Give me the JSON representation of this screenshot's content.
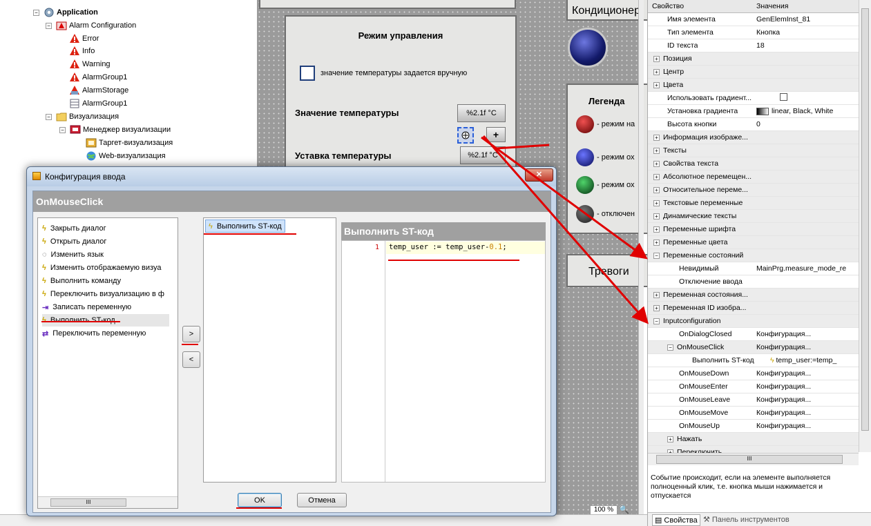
{
  "tree": {
    "items": [
      {
        "label": "Application",
        "icon": "gear-icon",
        "level": 0
      },
      {
        "label": "Alarm Configuration",
        "icon": "alarm-config-icon",
        "level": 1
      },
      {
        "label": "Error",
        "icon": "warning-icon",
        "level": 2
      },
      {
        "label": "Info",
        "icon": "warning-icon",
        "level": 2
      },
      {
        "label": "Warning",
        "icon": "warning-icon",
        "level": 2
      },
      {
        "label": "AlarmGroup1",
        "icon": "warning-icon",
        "level": 2
      },
      {
        "label": "AlarmStorage",
        "icon": "alarm-storage-icon",
        "level": 2
      },
      {
        "label": "AlarmGroup1",
        "icon": "table-icon",
        "level": 2
      },
      {
        "label": "Визуализация",
        "icon": "folder-icon",
        "level": 1
      },
      {
        "label": "Менеджер визуализации",
        "icon": "visu-manager-icon",
        "level": 2
      },
      {
        "label": "Таргет-визуализация",
        "icon": "target-visu-icon",
        "level": 3
      },
      {
        "label": "Web-визуализация",
        "icon": "web-visu-icon",
        "level": 3
      }
    ]
  },
  "canvas": {
    "mode_title": "Режим управления",
    "manual_checkbox_label": "значение температуры задается вручную",
    "temp_value_label": "Значение температуры",
    "temp_value_format": "%2.1f °C",
    "setpoint_label": "Уставка температуры",
    "setpoint_format": "%2.1f °C",
    "plus_label": "+",
    "cond_title": "Кондиционер",
    "legend_title": "Легенда",
    "legend_items": [
      "- режим на",
      "- режим ох",
      "- режим ох",
      "- отключен"
    ],
    "alarm_title": "Тревоги",
    "zoom": "100 %"
  },
  "props": {
    "header": {
      "name": "Свойство",
      "value": "Значения"
    },
    "rows": [
      {
        "k": "Имя элемента",
        "v": "GenElemInst_81",
        "lvl": 1,
        "cat": false
      },
      {
        "k": "Тип элемента",
        "v": "Кнопка",
        "lvl": 1,
        "cat": false
      },
      {
        "k": "ID текста",
        "v": "18",
        "lvl": 1,
        "cat": false
      },
      {
        "k": "Позиция",
        "v": "",
        "lvl": 0,
        "cat": true,
        "pm": "+"
      },
      {
        "k": "Центр",
        "v": "",
        "lvl": 0,
        "cat": true,
        "pm": "+"
      },
      {
        "k": "Цвета",
        "v": "",
        "lvl": 0,
        "cat": true,
        "pm": "+"
      },
      {
        "k": "Использовать градиент...",
        "v": "",
        "lvl": 1,
        "cat": false,
        "check": true
      },
      {
        "k": "Установка градиента",
        "v": "linear, Black, White",
        "lvl": 1,
        "cat": false,
        "grad": true
      },
      {
        "k": "Высота кнопки",
        "v": "0",
        "lvl": 1,
        "cat": false
      },
      {
        "k": "Информация изображе...",
        "v": "",
        "lvl": 0,
        "cat": true,
        "pm": "+"
      },
      {
        "k": "Тексты",
        "v": "",
        "lvl": 0,
        "cat": true,
        "pm": "+"
      },
      {
        "k": "Свойства текста",
        "v": "",
        "lvl": 0,
        "cat": true,
        "pm": "+"
      },
      {
        "k": "Абсолютное перемещен...",
        "v": "",
        "lvl": 0,
        "cat": true,
        "pm": "+"
      },
      {
        "k": "Относительное переме...",
        "v": "",
        "lvl": 0,
        "cat": true,
        "pm": "+"
      },
      {
        "k": "Текстовые переменные",
        "v": "",
        "lvl": 0,
        "cat": true,
        "pm": "+"
      },
      {
        "k": "Динамические тексты",
        "v": "",
        "lvl": 0,
        "cat": true,
        "pm": "+"
      },
      {
        "k": "Переменные шрифта",
        "v": "",
        "lvl": 0,
        "cat": true,
        "pm": "+"
      },
      {
        "k": "Переменные цвета",
        "v": "",
        "lvl": 0,
        "cat": true,
        "pm": "+"
      },
      {
        "k": "Переменные состояний",
        "v": "",
        "lvl": 0,
        "cat": true,
        "pm": "−"
      },
      {
        "k": "Невидимый",
        "v": "MainPrg.measure_mode_re",
        "lvl": 2,
        "cat": false
      },
      {
        "k": "Отключение ввода",
        "v": "",
        "lvl": 2,
        "cat": false
      },
      {
        "k": "Переменная состояния...",
        "v": "",
        "lvl": 0,
        "cat": true,
        "pm": "+"
      },
      {
        "k": "Переменная ID изобра...",
        "v": "",
        "lvl": 0,
        "cat": true,
        "pm": "+"
      },
      {
        "k": "Inputconfiguration",
        "v": "",
        "lvl": 0,
        "cat": true,
        "pm": "−"
      },
      {
        "k": "OnDialogClosed",
        "v": "Конфигурация...",
        "lvl": 2,
        "cat": false
      },
      {
        "k": "OnMouseClick",
        "v": "Конфигурация...",
        "lvl": 1,
        "cat": true,
        "pm": "−"
      },
      {
        "k": "Выполнить ST-код",
        "v": "temp_user:=temp_",
        "lvl": 3,
        "cat": false,
        "bolt": true
      },
      {
        "k": "OnMouseDown",
        "v": "Конфигурация...",
        "lvl": 2,
        "cat": false
      },
      {
        "k": "OnMouseEnter",
        "v": "Конфигурация...",
        "lvl": 2,
        "cat": false
      },
      {
        "k": "OnMouseLeave",
        "v": "Конфигурация...",
        "lvl": 2,
        "cat": false
      },
      {
        "k": "OnMouseMove",
        "v": "Конфигурация...",
        "lvl": 2,
        "cat": false
      },
      {
        "k": "OnMouseUp",
        "v": "Конфигурация...",
        "lvl": 2,
        "cat": false
      },
      {
        "k": "Нажать",
        "v": "",
        "lvl": 1,
        "cat": true,
        "pm": "+"
      },
      {
        "k": "Переключить",
        "v": "",
        "lvl": 1,
        "cat": true,
        "pm": "+"
      }
    ],
    "description": "Событие происходит, если на элементе выполняется полноценный клик, т.е. кнопка мыши нажимается и отпускается",
    "tab_properties": "Свойства",
    "tab_toolbox": "Панель инструментов",
    "scroll_glyph": "III"
  },
  "dialog": {
    "title": "Конфигурация ввода",
    "event_header": "OnMouseClick",
    "actions": [
      "Закрыть диалог",
      "Открыть диалог",
      "Изменить язык",
      "Изменить отображаемую визуа",
      "Выполнить команду",
      "Переключить визуализацию в ф",
      "Записать переменную",
      "Выполнить ST-код",
      "Переключить переменную"
    ],
    "action_icons": [
      "bolt-icon",
      "bolt-icon",
      "speech-icon",
      "bolt-icon",
      "bolt-icon",
      "bolt-icon",
      "write-var-icon",
      "bolt-icon",
      "toggle-var-icon"
    ],
    "selected_action": "Выполнить ST-код",
    "editor_header": "Выполнить ST-код",
    "code_line_no": "1",
    "code_text": "temp_user := temp_user-",
    "code_number": "0.1",
    "code_end": ";",
    "add_button": ">",
    "remove_button": "<",
    "ok": "OK",
    "cancel": "Отмена",
    "scroll_glyph": "III"
  },
  "colors": {
    "annotation": "#e00000",
    "selection": "#3399ff",
    "header_gray": "#a0a0a0"
  }
}
